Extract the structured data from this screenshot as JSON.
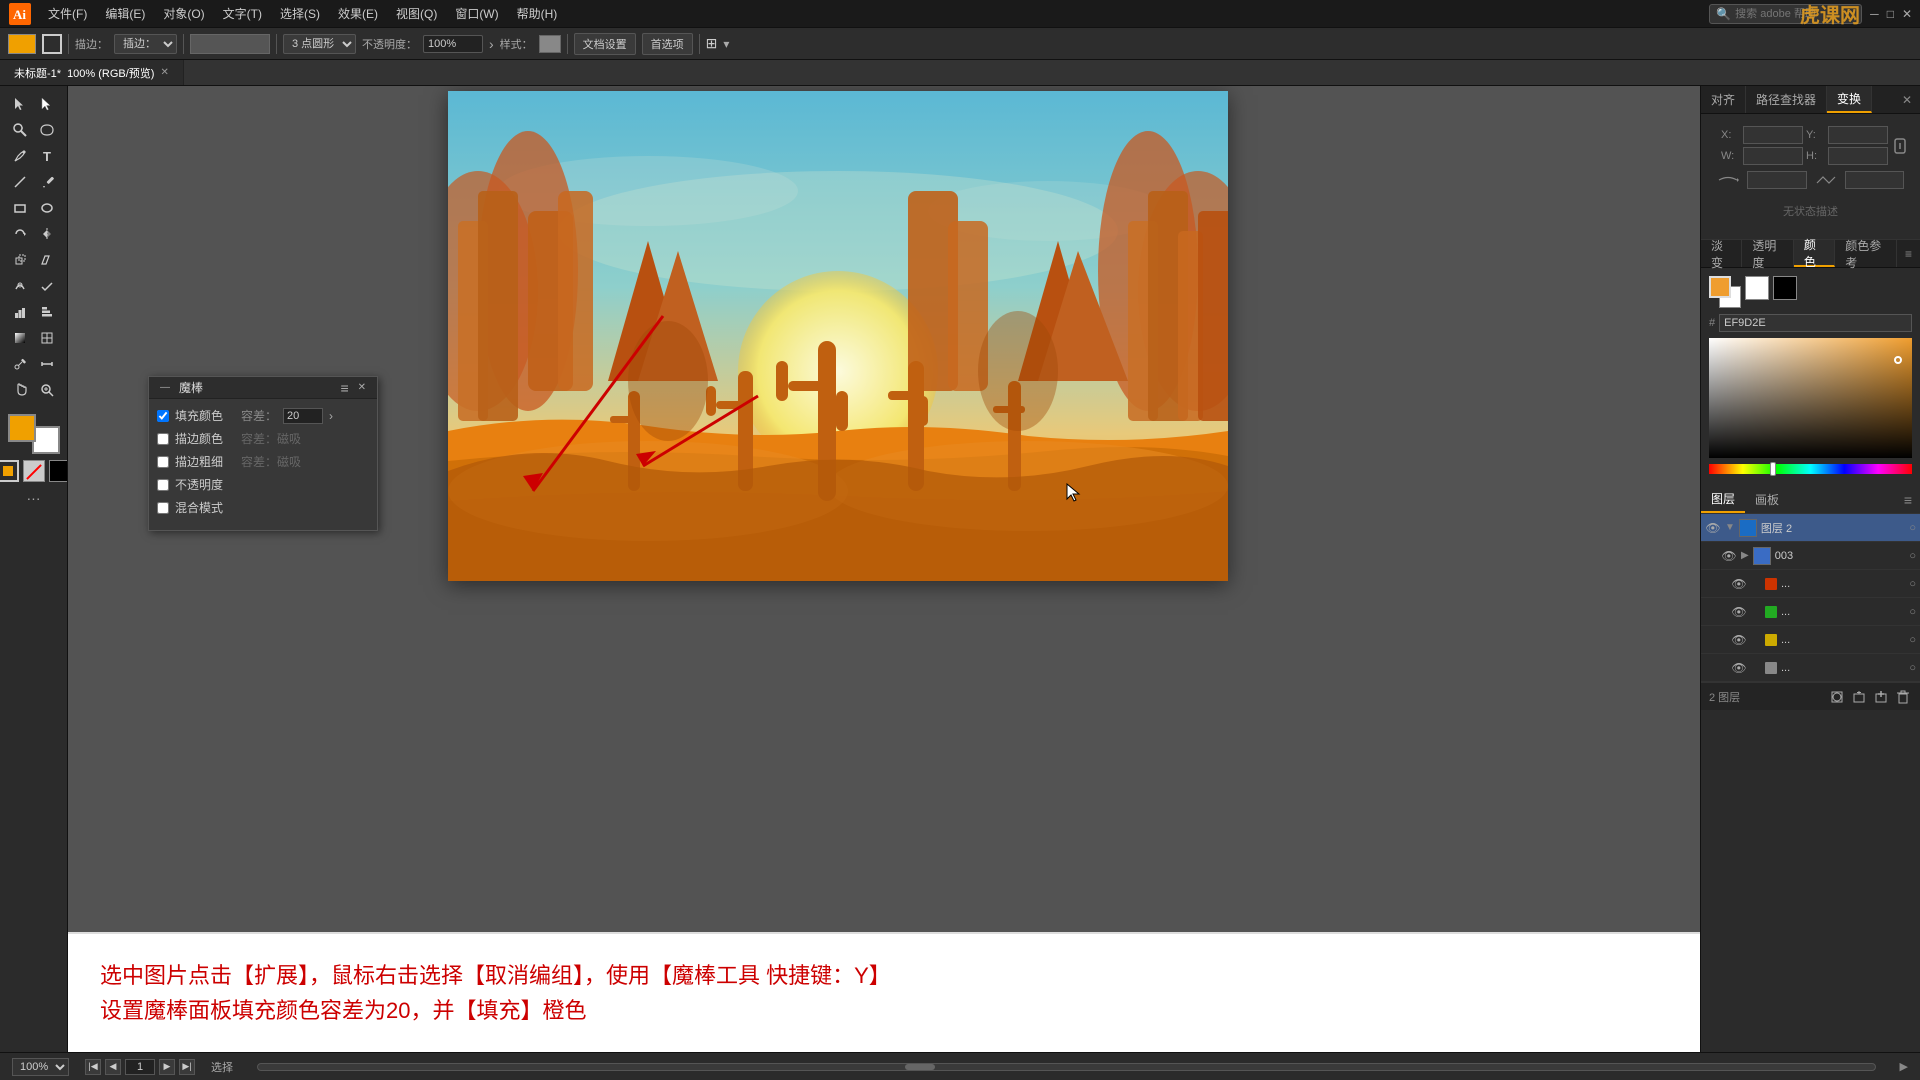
{
  "app": {
    "title": "Adobe Illustrator",
    "logo_text": "Ai"
  },
  "menu_bar": {
    "items": [
      "文件(F)",
      "编辑(E)",
      "对象(O)",
      "文字(T)",
      "选择(S)",
      "效果(E)",
      "视图(Q)",
      "窗口(W)",
      "帮助(H)"
    ],
    "search_placeholder": "搜索 adobe 帮助",
    "watermark": "虎课网"
  },
  "toolbar": {
    "stroke_label": "描边：",
    "mode_label": "插边：",
    "point_label": "3 点圆形",
    "opacity_label": "不透明度：",
    "opacity_value": "100%",
    "style_label": "样式：",
    "doc_settings_label": "文档设置",
    "preferences_label": "首选项"
  },
  "tab": {
    "name": "未标题-1*",
    "info": "100% (RGB/预览)"
  },
  "magic_wand_panel": {
    "title": "魔棒",
    "fill_color_label": "填充颜色",
    "fill_color_checked": true,
    "tolerance_label": "容差：",
    "tolerance_value": "20",
    "stroke_color_label": "描边颜色",
    "stroke_color_checked": false,
    "stroke_width_label": "描边粗细",
    "stroke_width_checked": false,
    "opacity_label": "不透明度",
    "opacity_checked": false,
    "blend_mode_label": "混合模式",
    "blend_mode_checked": false
  },
  "transform_panel": {
    "tabs": [
      "对齐",
      "路径查找器",
      "变换"
    ],
    "active_tab": "变换",
    "x_label": "X",
    "x_value": "",
    "y_label": "Y",
    "y_value": "",
    "w_label": "W",
    "w_value": "",
    "h_label": "H",
    "h_value": "",
    "no_selection": "无状态描述"
  },
  "color_panel": {
    "tabs": [
      "淡变",
      "透明度",
      "颜色",
      "颜色参考"
    ],
    "active_tab": "颜色",
    "hex_label": "#",
    "hex_value": "EF9D2E"
  },
  "layers_panel": {
    "tabs": [
      "图层",
      "画板"
    ],
    "active_tab": "图层",
    "layers": [
      {
        "name": "图层 2",
        "type": "group",
        "visible": true,
        "expanded": true,
        "color": "#1a6cc4",
        "locked": false
      },
      {
        "name": "003",
        "type": "item",
        "visible": true,
        "expanded": false,
        "color": "#1a6cc4",
        "locked": false
      },
      {
        "name": "...",
        "type": "item",
        "visible": true,
        "color": "#cc3300",
        "locked": false
      },
      {
        "name": "...",
        "type": "item",
        "visible": true,
        "color": "#22aa22",
        "locked": false
      },
      {
        "name": "...",
        "type": "item",
        "visible": true,
        "color": "#ccaa00",
        "locked": false
      },
      {
        "name": "...",
        "type": "item",
        "visible": true,
        "color": "#888888",
        "locked": false
      }
    ],
    "bottom": {
      "layer_count_label": "2 图层"
    }
  },
  "instruction": {
    "line1": "选中图片点击【扩展】，鼠标右击选择【取消编组】，使用【魔棒工具 快捷键：Y】",
    "line2": "设置魔棒面板填充颜色容差为20，并【填充】橙色"
  },
  "status_bar": {
    "zoom": "100%",
    "page": "1",
    "action_label": "选择"
  }
}
